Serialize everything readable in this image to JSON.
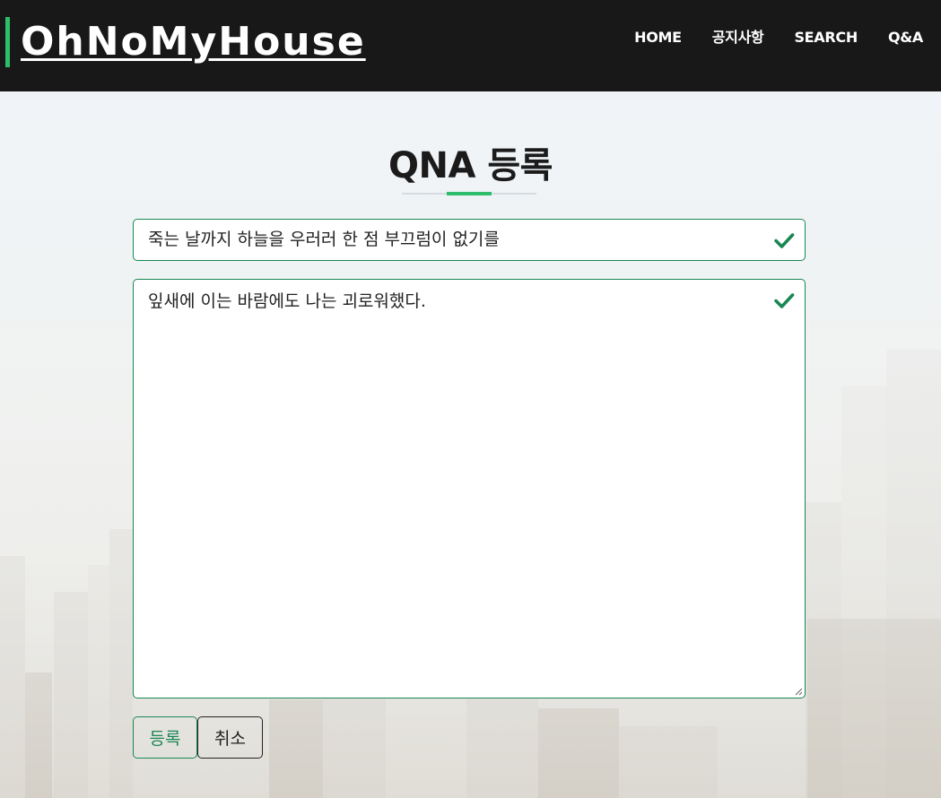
{
  "header": {
    "logo": "OhNoMyHouse",
    "nav": [
      "HOME",
      "공지사항",
      "SEARCH",
      "Q&A"
    ]
  },
  "page": {
    "title": "QNA 등록"
  },
  "form": {
    "subject_value": "죽는 날까지 하늘을 우러러 한 점 부끄럼이 없기를",
    "content_value": "잎새에 이는 바람에도 나는 괴로워했다.",
    "submit_label": "등록",
    "cancel_label": "취소"
  },
  "colors": {
    "header_bg": "#181818",
    "accent": "#2ebd6b",
    "valid": "#198754"
  }
}
